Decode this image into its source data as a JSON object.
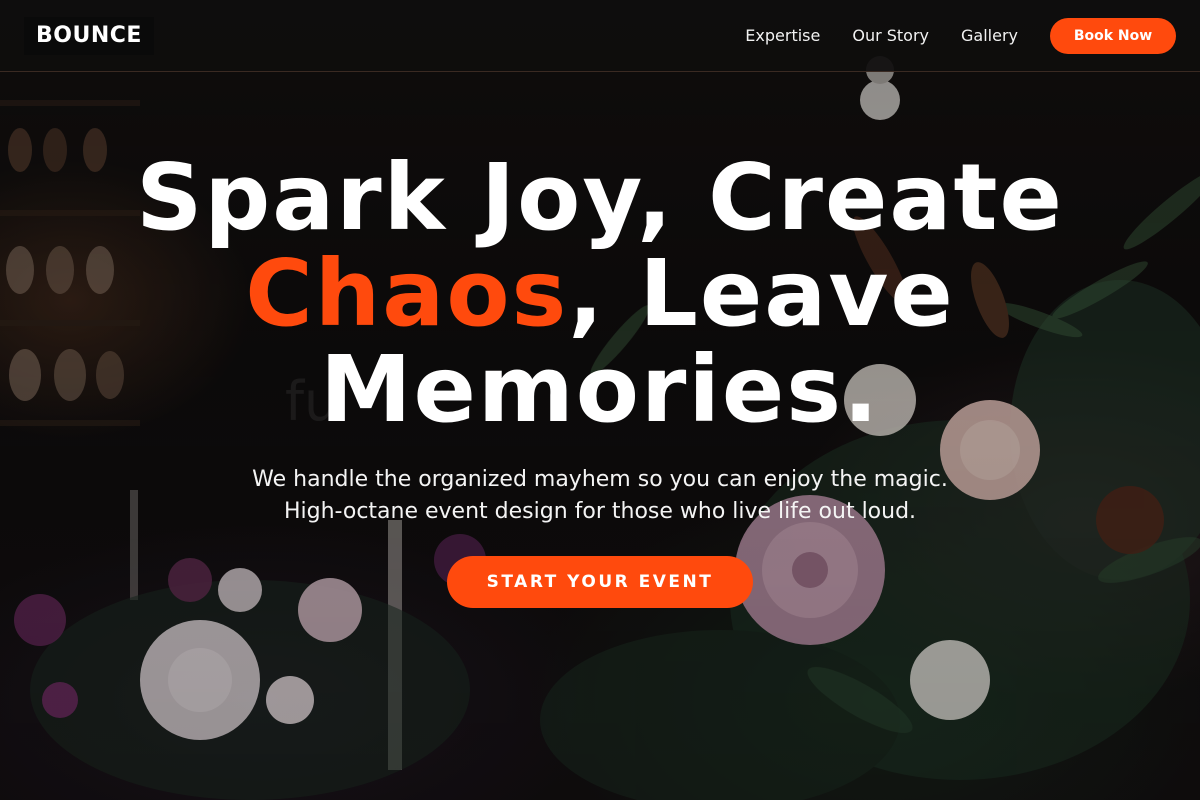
{
  "brand": {
    "logo_text": "BOUNCE"
  },
  "nav": {
    "links": [
      {
        "label": "Expertise"
      },
      {
        "label": "Our Story"
      },
      {
        "label": "Gallery"
      }
    ],
    "book_label": "Book Now"
  },
  "hero": {
    "headline_part1": "Spark Joy, Create",
    "headline_accent": "Chaos",
    "headline_part2": ", Leave",
    "headline_part3": "Memories.",
    "subtext": "We handle the organized mayhem so you can enjoy the magic. High-octane event design for those who live life out loud.",
    "cta_label": "START YOUR EVENT",
    "background": "floral-event-photo"
  },
  "colors": {
    "accent": "#ff4a0d",
    "nav_background": "#0e0d0d",
    "text": "#ffffff"
  }
}
